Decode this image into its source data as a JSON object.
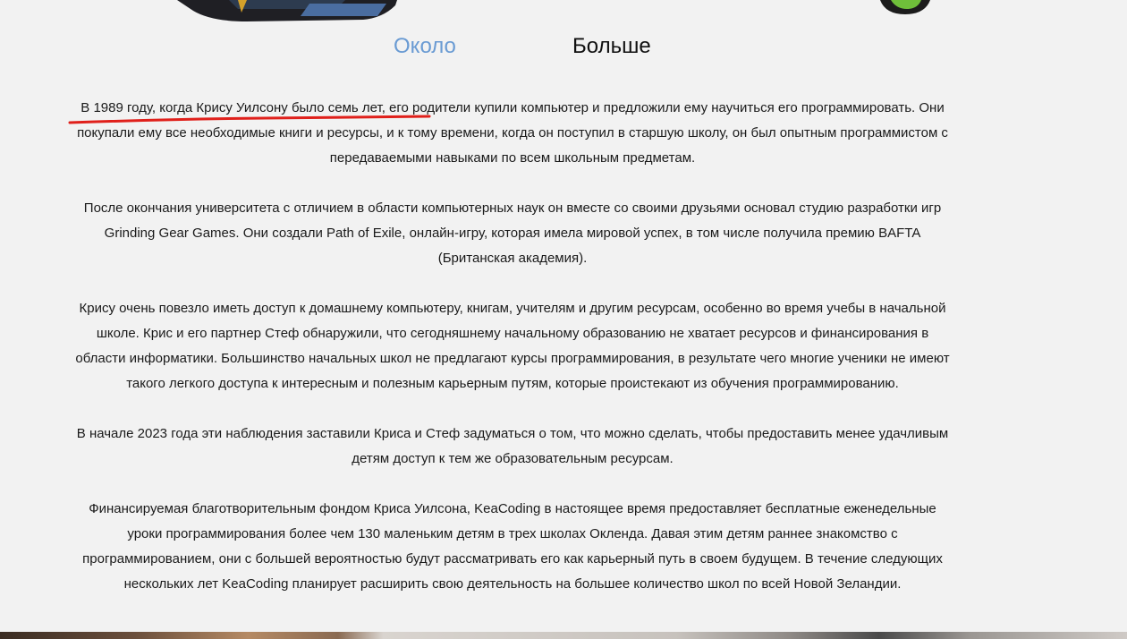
{
  "tabs": {
    "about_label": "Около",
    "more_label": "Больше"
  },
  "article": {
    "paragraphs": [
      "В 1989 году, когда Крису Уилсону было семь лет, его родители купили компьютер и предложили ему научиться его программировать. Они покупали ему все необходимые книги и ресурсы, и к тому времени, когда он поступил в старшую школу, он был опытным программистом с передаваемыми навыками по всем школьным предметам.",
      "После окончания университета с отличием в области компьютерных наук он вместе со своими друзьями основал студию разработки игр Grinding Gear Games. Они создали Path of Exile, онлайн-игру, которая имела мировой успех, в том числе получила премию BAFTA (Британская академия).",
      "Крису очень повезло иметь доступ к домашнему компьютеру, книгам, учителям и другим ресурсам, особенно во время учебы в начальной школе. Крис и его партнер Стеф обнаружили, что сегодняшнему начальному образованию не хватает ресурсов и финансирования в области информатики. Большинство начальных школ не предлагают курсы программирования, в результате чего многие ученики не имеют такого легкого доступа к интересным и полезным карьерным путям, которые проистекают из обучения программированию.",
      "В начале 2023 года эти наблюдения заставили Криса и Стеф задуматься о том, что можно сделать, чтобы предоставить менее удачливым детям доступ к тем же образовательным ресурсам.",
      "Финансируемая благотворительным фондом Криса Уилсона, KeaCoding в настоящее время предоставляет бесплатные еженедельные уроки программирования более чем 130 маленьким детям в трех школах Окленда. Давая этим детям раннее знакомство с программированием, они с большей вероятностью будут рассматривать его как карьерный путь в своем будущем. В течение следующих нескольких лет KeaCoding планирует расширить свою деятельность на большее количество школ по всей Новой Зеландии."
    ]
  },
  "colors": {
    "background": "#f2f2f2",
    "tab_active": "#6a9bd3",
    "tab_inactive": "#111111",
    "text": "#1a1a1a",
    "underline_annotation": "#e0201b"
  }
}
